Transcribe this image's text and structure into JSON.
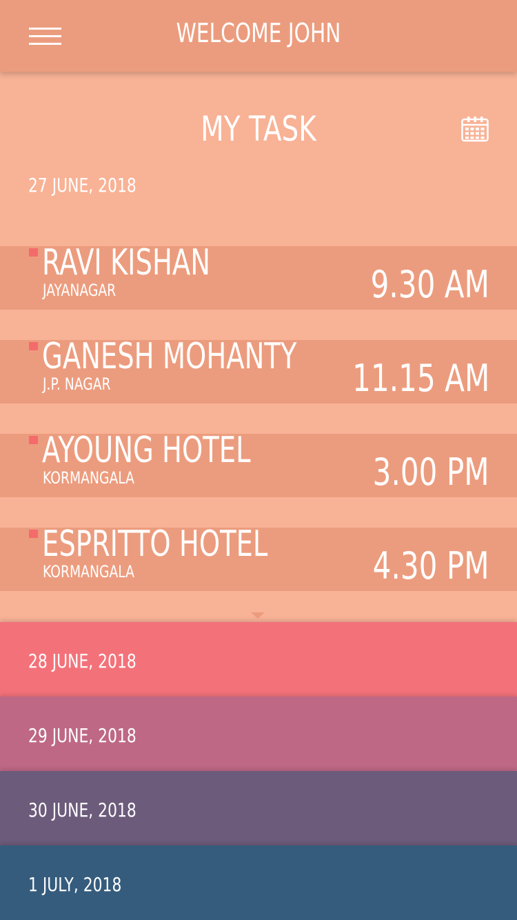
{
  "header": {
    "title": "WELCOME JOHN",
    "menu_icon": "hamburger-icon"
  },
  "section": {
    "title": "MY TASK",
    "calendar_icon": "calendar-icon",
    "date": "27 JUNE, 2018"
  },
  "tasks": [
    {
      "name": "RAVI KISHAN",
      "place": "JAYANAGAR",
      "time": "9.30 AM"
    },
    {
      "name": "GANESH MOHANTY",
      "place": "J.P. NAGAR",
      "time": "11.15 AM"
    },
    {
      "name": "AYOUNG HOTEL",
      "place": "KORMANGALA",
      "time": "3.00 PM"
    },
    {
      "name": "ESPRITTO HOTEL",
      "place": "KORMANGALA",
      "time": "4.30 PM"
    }
  ],
  "days": [
    {
      "label": "28 JUNE, 2018",
      "color": "#f3727a"
    },
    {
      "label": "29 JUNE, 2018",
      "color": "#be6885"
    },
    {
      "label": "30 JUNE, 2018",
      "color": "#6c5b7b"
    },
    {
      "label": "1 JULY, 2018",
      "color": "#355c7d"
    }
  ],
  "colors": {
    "header": "#ec9c7e",
    "panel": "#f8b296",
    "task_row": "#ec9c7e",
    "marker": "#f46b6b"
  }
}
